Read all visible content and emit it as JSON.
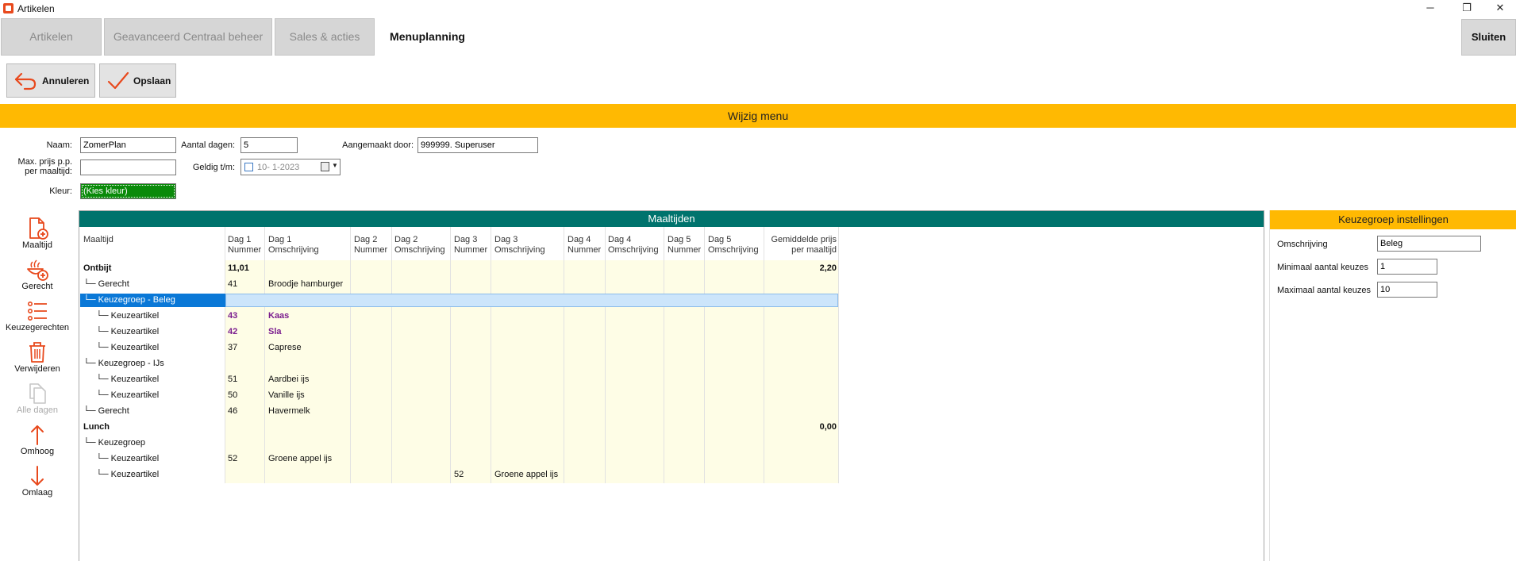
{
  "window": {
    "title": "Artikelen",
    "minimize": "─",
    "restore": "❐",
    "close": "✕"
  },
  "tabs": [
    {
      "label": "Artikelen"
    },
    {
      "label": "Geavanceerd Centraal beheer"
    },
    {
      "label": "Sales & acties"
    },
    {
      "label": "Menuplanning"
    }
  ],
  "close_button": "Sluiten",
  "toolbar": {
    "cancel_label": "Annuleren",
    "save_label": "Opslaan"
  },
  "section_title": "Wijzig menu",
  "form": {
    "name_label": "Naam:",
    "name_value": "ZomerPlan",
    "days_label": "Aantal dagen:",
    "days_value": "5",
    "created_by_label": "Aangemaakt door:",
    "created_by_value": "999999. Superuser",
    "max_price_label_1": "Max. prijs p.p.",
    "max_price_label_2": "per maaltijd:",
    "max_price_value": "",
    "valid_label": "Geldig t/m:",
    "valid_value": "10-  1-2023",
    "color_label": "Kleur:",
    "color_value": "(Kies kleur)",
    "color_hex": "#0a8a0a"
  },
  "sidebar": [
    {
      "label": "Maaltijd",
      "icon": "add-document-icon"
    },
    {
      "label": "Gerecht",
      "icon": "add-dish-icon"
    },
    {
      "label": "Keuzegerechten",
      "icon": "list-icon"
    },
    {
      "label": "Verwijderen",
      "icon": "trash-icon"
    },
    {
      "label": "Alle dagen",
      "icon": "copy-icon"
    },
    {
      "label": "Omhoog",
      "icon": "arrow-up-icon"
    },
    {
      "label": "Omlaag",
      "icon": "arrow-down-icon"
    }
  ],
  "grid": {
    "title": "Maaltijden",
    "headers": [
      {
        "l1": "Maaltijd",
        "l2": ""
      },
      {
        "l1": "Dag 1",
        "l2": "Nummer"
      },
      {
        "l1": "Dag 1",
        "l2": "Omschrijving"
      },
      {
        "l1": "Dag 2",
        "l2": "Nummer"
      },
      {
        "l1": "Dag 2",
        "l2": "Omschrijving"
      },
      {
        "l1": "Dag 3",
        "l2": "Nummer"
      },
      {
        "l1": "Dag 3",
        "l2": "Omschrijving"
      },
      {
        "l1": "Dag 4",
        "l2": "Nummer"
      },
      {
        "l1": "Dag 4",
        "l2": "Omschrijving"
      },
      {
        "l1": "Dag 5",
        "l2": "Nummer"
      },
      {
        "l1": "Dag 5",
        "l2": "Omschrijving"
      },
      {
        "l1": "Gemiddelde prijs",
        "l2": "per maaltijd"
      }
    ],
    "rows": [
      {
        "name": "Ontbijt",
        "d1n": "11,01",
        "d1o": "",
        "d3n": "",
        "d3o": "",
        "price": "2,20"
      },
      {
        "name": "└─ Gerecht",
        "d1n": "41",
        "d1o": "Broodje hamburger",
        "d3n": "",
        "d3o": "",
        "price": ""
      },
      {
        "name": "└─ Keuzegroep - Beleg",
        "d1n": "",
        "d1o": "",
        "d3n": "",
        "d3o": "",
        "price": ""
      },
      {
        "name": "└─ Keuzeartikel",
        "d1n": "43",
        "d1o": "Kaas",
        "d3n": "",
        "d3o": "",
        "price": ""
      },
      {
        "name": "└─ Keuzeartikel",
        "d1n": "42",
        "d1o": "Sla",
        "d3n": "",
        "d3o": "",
        "price": ""
      },
      {
        "name": "└─ Keuzeartikel",
        "d1n": "37",
        "d1o": "Caprese",
        "d3n": "",
        "d3o": "",
        "price": ""
      },
      {
        "name": "└─ Keuzegroep - IJs",
        "d1n": "",
        "d1o": "",
        "d3n": "",
        "d3o": "",
        "price": ""
      },
      {
        "name": "└─ Keuzeartikel",
        "d1n": "51",
        "d1o": "Aardbei ijs",
        "d3n": "",
        "d3o": "",
        "price": ""
      },
      {
        "name": "└─ Keuzeartikel",
        "d1n": "50",
        "d1o": "Vanille ijs",
        "d3n": "",
        "d3o": "",
        "price": ""
      },
      {
        "name": "└─ Gerecht",
        "d1n": "46",
        "d1o": "Havermelk",
        "d3n": "",
        "d3o": "",
        "price": ""
      },
      {
        "name": "Lunch",
        "d1n": "",
        "d1o": "",
        "d3n": "",
        "d3o": "",
        "price": "0,00"
      },
      {
        "name": "└─ Keuzegroep",
        "d1n": "",
        "d1o": "",
        "d3n": "",
        "d3o": "",
        "price": ""
      },
      {
        "name": "└─ Keuzeartikel",
        "d1n": "52",
        "d1o": "Groene appel ijs",
        "d3n": "",
        "d3o": "",
        "price": ""
      },
      {
        "name": "└─ Keuzeartikel",
        "d1n": "",
        "d1o": "",
        "d3n": "52",
        "d3o": "Groene appel ijs",
        "price": ""
      }
    ]
  },
  "settings": {
    "title": "Keuzegroep instellingen",
    "desc_label": "Omschrijving",
    "desc_value": "Beleg",
    "min_label": "Minimaal aantal keuzes",
    "min_value": "1",
    "max_label": "Maximaal aantal keuzes",
    "max_value": "10"
  },
  "colors": {
    "accent_orange": "#ffb902",
    "grid_header_teal": "#00736d",
    "selection_blue": "#0a78d7",
    "icon_orange": "#e8491d",
    "purple_text": "#7a1c8e"
  }
}
